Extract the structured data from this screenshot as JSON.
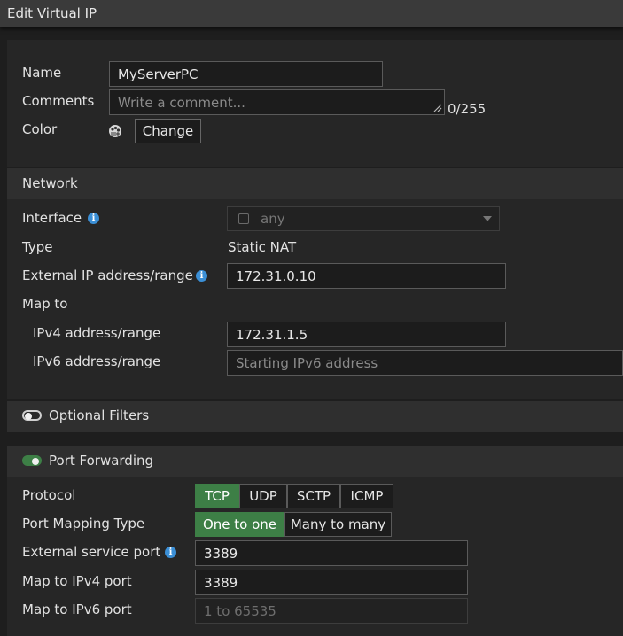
{
  "title": "Edit Virtual IP",
  "general": {
    "name_label": "Name",
    "name_value": "MyServerPC",
    "comments_label": "Comments",
    "comments_placeholder": "Write a comment...",
    "comments_counter": "0/255",
    "color_label": "Color",
    "color_button": "Change",
    "color_icon": "palette-icon"
  },
  "network": {
    "header": "Network",
    "interface_label": "Interface",
    "interface_value": "any",
    "type_label": "Type",
    "type_value": "Static NAT",
    "external_ip_label": "External IP address/range",
    "external_ip_value": "172.31.0.10",
    "map_to_label": "Map to",
    "ipv4_label": "IPv4 address/range",
    "ipv4_value": "172.31.1.5",
    "ipv6_label": "IPv6 address/range",
    "ipv6_placeholder": "Starting IPv6 address"
  },
  "optional_filters": {
    "label": "Optional Filters",
    "enabled": false
  },
  "port_forwarding": {
    "label": "Port Forwarding",
    "enabled": true,
    "protocol_label": "Protocol",
    "protocols": [
      "TCP",
      "UDP",
      "SCTP",
      "ICMP"
    ],
    "protocol_selected": "TCP",
    "mapping_type_label": "Port Mapping Type",
    "mapping_types": [
      "One to one",
      "Many to many"
    ],
    "mapping_selected": "One to one",
    "external_port_label": "External service port",
    "external_port_value": "3389",
    "ipv4_port_label": "Map to IPv4 port",
    "ipv4_port_value": "3389",
    "ipv6_port_label": "Map to IPv6 port",
    "ipv6_port_placeholder": "1 to 65535"
  },
  "colors": {
    "accent_green": "#3d7f46",
    "info_blue": "#3b8fd6"
  }
}
